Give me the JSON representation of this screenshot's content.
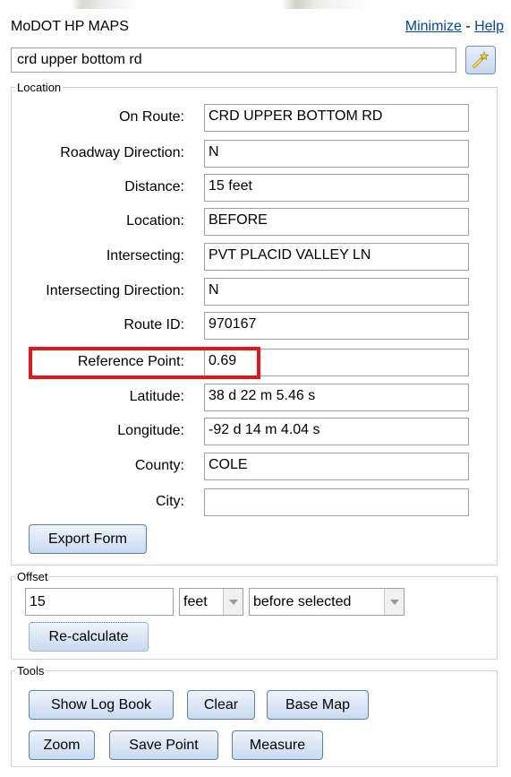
{
  "app": {
    "title": "MoDOT HP MAPS",
    "minimize_label": "Minimize",
    "separator": "-",
    "help_label": "Help"
  },
  "search": {
    "value": "crd upper bottom rd",
    "button_icon": "wand-icon"
  },
  "location": {
    "legend": "Location",
    "fields": [
      {
        "label": "On Route:",
        "value": "CRD UPPER BOTTOM RD"
      },
      {
        "label": "Roadway Direction:",
        "value": "N"
      },
      {
        "label": "Distance:",
        "value": "15 feet"
      },
      {
        "label": "Location:",
        "value": "BEFORE"
      },
      {
        "label": "Intersecting:",
        "value": "PVT PLACID VALLEY LN"
      },
      {
        "label": "Intersecting Direction:",
        "value": "N"
      },
      {
        "label": "Route ID:",
        "value": "970167"
      },
      {
        "label": "Reference Point:",
        "value": "0.69"
      },
      {
        "label": "Latitude:",
        "value": "38 d 22 m 5.46 s"
      },
      {
        "label": "Longitude:",
        "value": "-92 d 14 m 4.04 s"
      },
      {
        "label": "County:",
        "value": "COLE"
      },
      {
        "label": "City:",
        "value": ""
      }
    ],
    "export_label": "Export Form",
    "highlight_color": "#e8141c"
  },
  "offset": {
    "legend": "Offset",
    "value": "15",
    "unit": "feet",
    "position": "before selected",
    "recalc_label": "Re-calculate"
  },
  "tools": {
    "legend": "Tools",
    "buttons": [
      "Show Log Book",
      "Clear",
      "Base Map",
      "Zoom",
      "Save Point",
      "Measure"
    ]
  }
}
